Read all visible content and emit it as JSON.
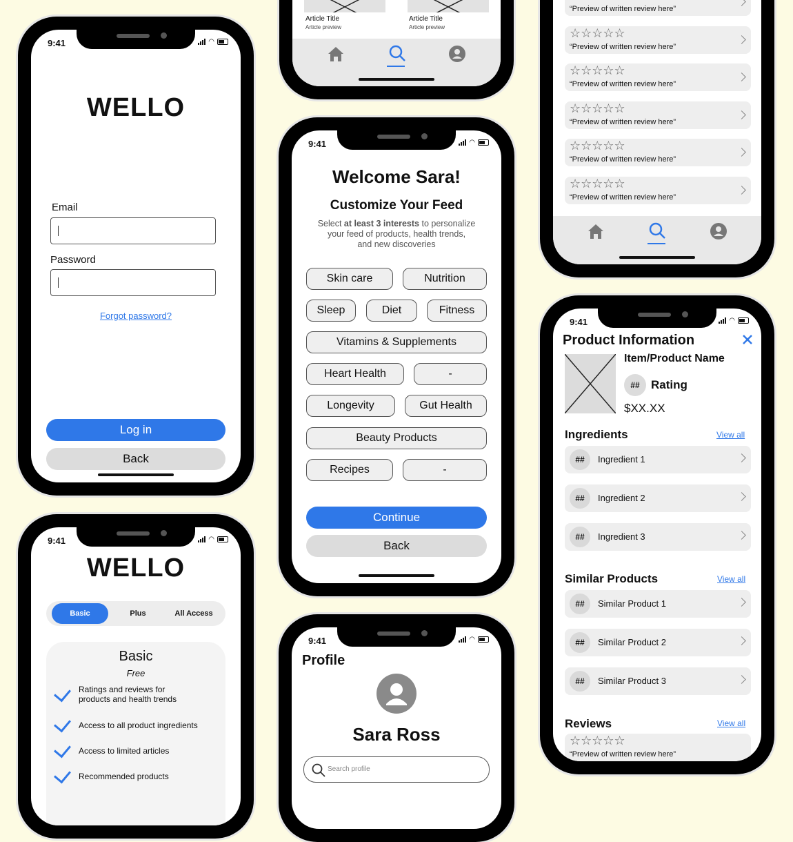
{
  "status": {
    "time": "9:41"
  },
  "login": {
    "logo": "WELLO",
    "email_label": "Email",
    "password_label": "Password",
    "forgot": "Forgot password?",
    "login_btn": "Log in",
    "back_btn": "Back"
  },
  "articles": {
    "items": [
      {
        "title": "Article Title",
        "preview": "Article preview"
      },
      {
        "title": "Article Title",
        "preview": "Article preview"
      }
    ]
  },
  "reviews_list": {
    "stars": "☆☆☆☆☆",
    "preview": "“Preview of written review here”"
  },
  "welcome": {
    "title": "Welcome Sara!",
    "subtitle": "Customize Your Feed",
    "desc_1": "Select ",
    "desc_bold": "at least 3 interests",
    "desc_2": " to personalize",
    "desc_3": "your feed of products, health trends,",
    "desc_4": "and new discoveries",
    "chips": [
      "Skin care",
      "Nutrition",
      "Sleep",
      "Diet",
      "Fitness",
      "Vitamins & Supplements",
      "Heart Health",
      "-",
      "Longevity",
      "Gut Health",
      "Beauty Products",
      "Recipes",
      "-"
    ],
    "continue_btn": "Continue",
    "back_btn": "Back"
  },
  "plans": {
    "logo": "WELLO",
    "tabs": [
      "Basic",
      "Plus",
      "All Access"
    ],
    "card_title": "Basic",
    "card_price": "Free",
    "features": [
      "Ratings and reviews for products and health trends",
      "Access to all product ingredients",
      "Access to limited articles",
      "Recommended products"
    ]
  },
  "profile": {
    "title": "Profile",
    "name": "Sara Ross",
    "search_placeholder": "Search profile"
  },
  "product": {
    "header": "Product Information",
    "name": "Item/Product Name",
    "rating_num": "##",
    "rating_label": "Rating",
    "price": "$XX.XX",
    "ingredients_title": "Ingredients",
    "similar_title": "Similar Products",
    "reviews_title": "Reviews",
    "view_all": "View all",
    "ingredients": [
      "Ingredient 1",
      "Ingredient 2",
      "Ingredient 3"
    ],
    "similar": [
      "Similar Product 1",
      "Similar Product 2",
      "Similar Product 3"
    ],
    "num": "##",
    "review_stars": "☆☆☆☆☆",
    "review_preview": "“Preview of written review here”"
  },
  "colors": {
    "accent": "#2f78e8",
    "background": "#fdfbe3"
  },
  "icons": [
    "home-icon",
    "search-icon",
    "account-icon",
    "close-icon",
    "chevron-right-icon",
    "check-icon",
    "avatar-icon"
  ]
}
